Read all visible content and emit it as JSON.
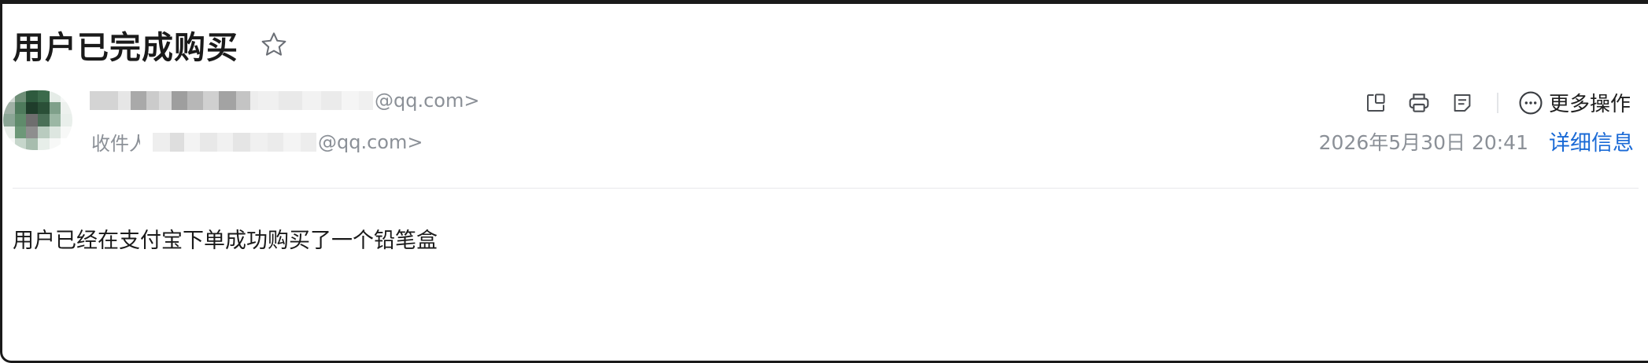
{
  "mail": {
    "subject": "用户已完成购买",
    "sender_suffix": "@qq.com>",
    "recipient_label": "收件人",
    "recipient_suffix": "@qq.com>",
    "date": "2026年5月30日 20:41",
    "details_link": "详细信息",
    "more_actions": "更多操作",
    "body": "用户已经在支付宝下单成功购买了一个铅笔盒"
  },
  "toolbar": {
    "icons": [
      "new-window-icon",
      "print-icon",
      "note-icon",
      "more-icon"
    ]
  },
  "colors": {
    "link": "#1a6ad6",
    "muted_text": "#8b9097",
    "primary_text": "#1a1a1a"
  }
}
